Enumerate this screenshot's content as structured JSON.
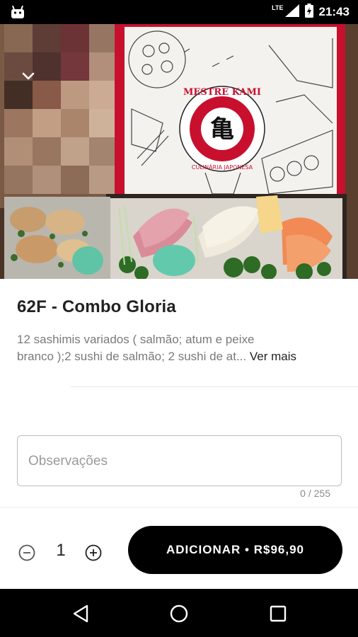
{
  "status_bar": {
    "time": "21:43",
    "network": "LTE",
    "icons": [
      "android-icon",
      "signal-icon",
      "battery-icon"
    ]
  },
  "product": {
    "title": "62F - Combo Gloria",
    "description_line1": "12 sashimis  variados ( salmão; atum e peixe",
    "description_line2": "branco );2 sushi de salmão; 2 sushi de at...",
    "read_more": "Ver mais",
    "image_alt": "Mestre Kami sashimi combo box photo",
    "brand_text": "MESTRE KAMI",
    "brand_subtext": "CULINÁRIA JAPONESA"
  },
  "notes": {
    "placeholder": "Observações",
    "value": "",
    "counter": "0 / 255"
  },
  "cart": {
    "quantity": "1",
    "add_label": "ADICIONAR • R$96,90"
  },
  "colors": {
    "primary": "#000000",
    "box_red": "#c8102e",
    "text": "#222222",
    "muted": "#7a7a7a"
  }
}
